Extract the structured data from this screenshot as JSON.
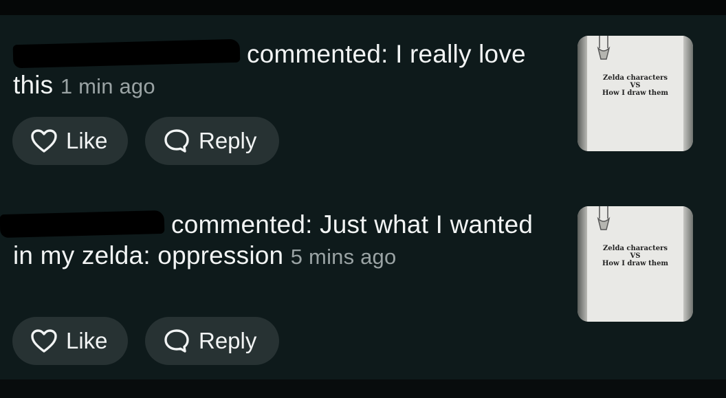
{
  "comments": [
    {
      "author": "",
      "action": "commented:",
      "text": "I really love this",
      "time": "1 min ago",
      "like_label": "Like",
      "reply_label": "Reply",
      "thumbnail": {
        "line1": "Zelda characters",
        "line2": "VS",
        "line3": "How I draw them"
      }
    },
    {
      "author": "",
      "action": "commented:",
      "text": "Just what I wanted in my zelda: oppression",
      "time": "5 mins ago",
      "like_label": "Like",
      "reply_label": "Reply",
      "thumbnail": {
        "line1": "Zelda characters",
        "line2": "VS",
        "line3": "How I draw them"
      }
    }
  ],
  "icons": {
    "like": "heart-outline-icon",
    "reply": "speech-bubble-icon"
  },
  "colors": {
    "background": "#0e1a1b",
    "pill": "#273233",
    "text": "#f2f4f4",
    "timestamp": "#9aa3a4"
  }
}
